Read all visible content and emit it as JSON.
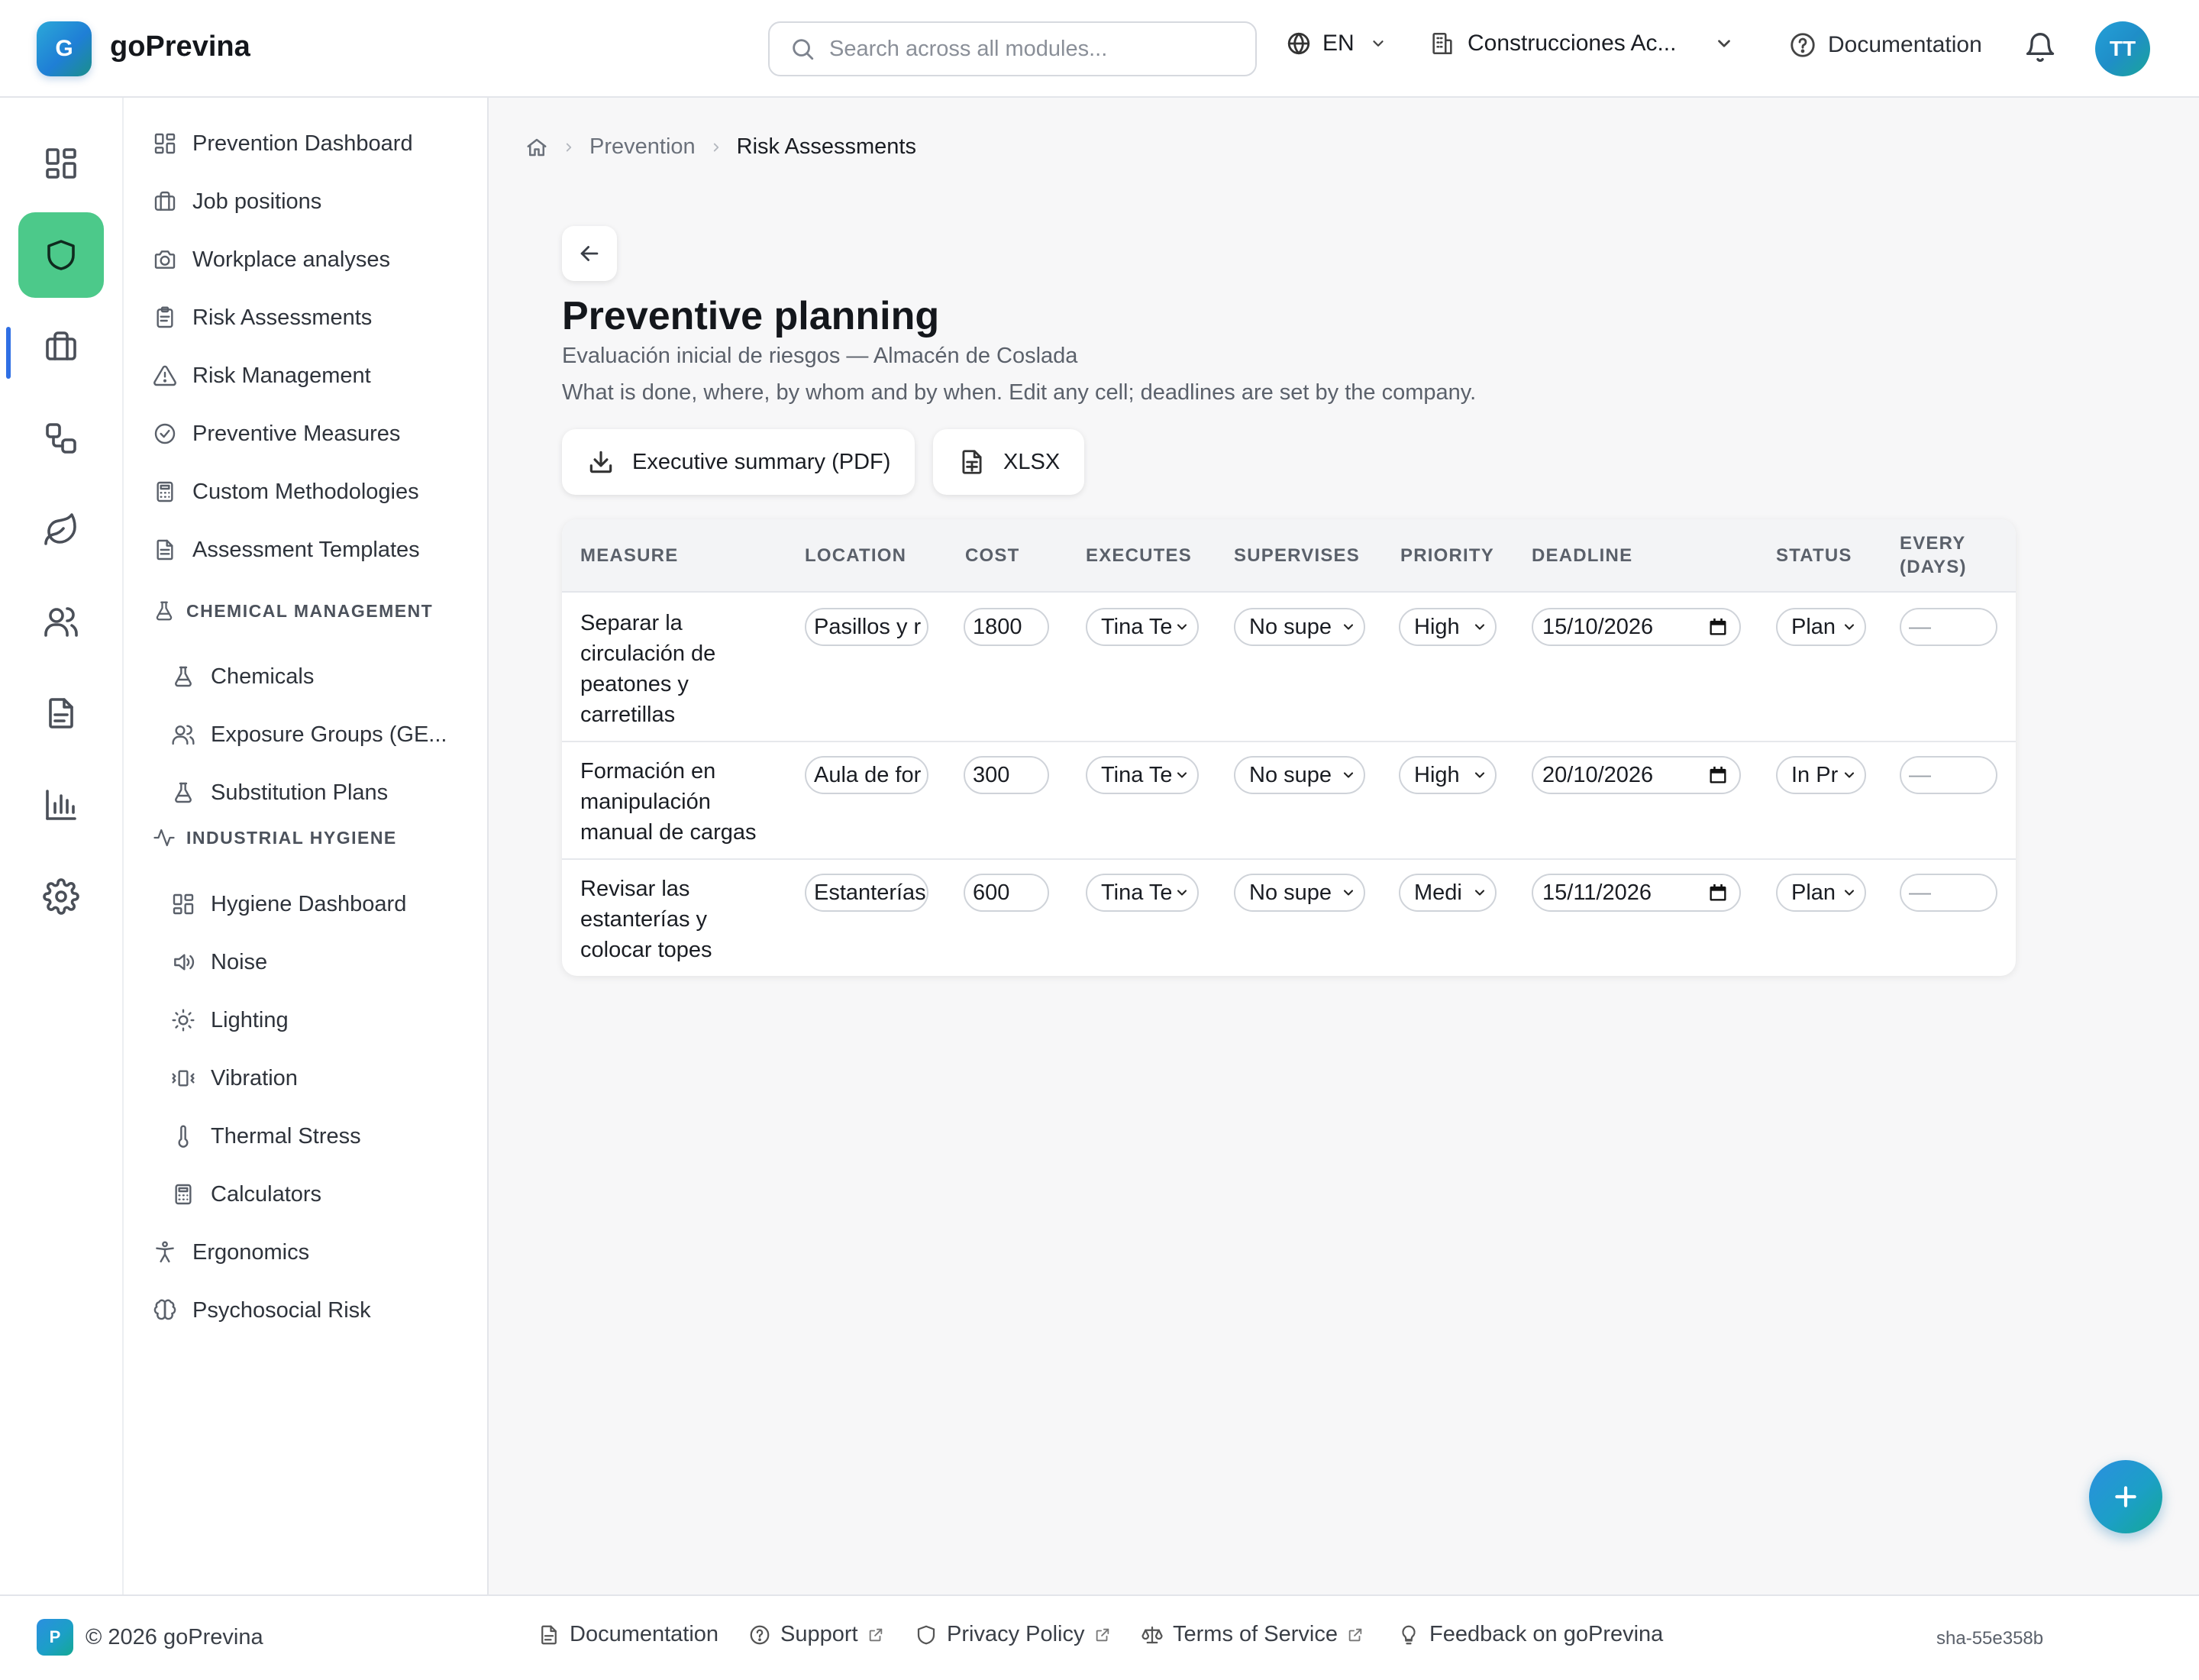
{
  "header": {
    "brand_initial": "G",
    "brand_name": "goPrevina",
    "search_placeholder": "Search across all modules...",
    "language": "EN",
    "company": "Construcciones Ac...",
    "documentation": "Documentation",
    "avatar_initials": "TT"
  },
  "rail": {
    "items": [
      "dashboard-icon",
      "shield-icon",
      "briefcase-icon",
      "workflow-icon",
      "leaf-icon",
      "users-icon",
      "document-icon",
      "bar-chart-icon",
      "gear-icon"
    ],
    "active_index": 1,
    "active_color": "#4cc98a"
  },
  "sidebar": {
    "items": [
      {
        "label": "Prevention Dashboard",
        "icon": "dashboard-icon"
      },
      {
        "label": "Job positions",
        "icon": "briefcase-icon"
      },
      {
        "label": "Workplace analyses",
        "icon": "camera-icon"
      },
      {
        "label": "Risk Assessments",
        "icon": "clipboard-icon"
      },
      {
        "label": "Risk Management",
        "icon": "warning-icon"
      },
      {
        "label": "Preventive Measures",
        "icon": "check-circle-icon"
      },
      {
        "label": "Custom Methodologies",
        "icon": "calculator-icon"
      },
      {
        "label": "Assessment Templates",
        "icon": "file-icon"
      }
    ],
    "chemical_section": "CHEMICAL MANAGEMENT",
    "chemical_items": [
      {
        "label": "Chemicals",
        "icon": "flask-icon"
      },
      {
        "label": "Exposure Groups (GE...",
        "icon": "users-icon"
      },
      {
        "label": "Substitution Plans",
        "icon": "flask-icon"
      }
    ],
    "hygiene_section": "INDUSTRIAL HYGIENE",
    "hygiene_items": [
      {
        "label": "Hygiene Dashboard",
        "icon": "dashboard-icon"
      },
      {
        "label": "Noise",
        "icon": "speaker-icon"
      },
      {
        "label": "Lighting",
        "icon": "sun-icon"
      },
      {
        "label": "Vibration",
        "icon": "vibration-icon"
      },
      {
        "label": "Thermal Stress",
        "icon": "thermometer-icon"
      },
      {
        "label": "Calculators",
        "icon": "calculator-icon"
      }
    ],
    "bottom_items": [
      {
        "label": "Ergonomics",
        "icon": "person-icon"
      },
      {
        "label": "Psychosocial Risk",
        "icon": "brain-icon"
      }
    ]
  },
  "breadcrumb": {
    "prevention": "Prevention",
    "current": "Risk Assessments"
  },
  "page": {
    "title": "Preventive planning",
    "subtitle": "Evaluación inicial de riesgos — Almacén de Coslada",
    "description": "What is done, where, by whom and by when. Edit any cell; deadlines are set by the company.",
    "pdf_button": "Executive summary (PDF)",
    "xlsx_button": "XLSX"
  },
  "table": {
    "headers": {
      "measure": "MEASURE",
      "location": "LOCATION",
      "cost": "COST",
      "executes": "EXECUTES",
      "supervises": "SUPERVISES",
      "priority": "PRIORITY",
      "deadline": "DEADLINE",
      "status": "STATUS",
      "every_line1": "EVERY",
      "every_line2": "(DAYS)"
    },
    "rows": [
      {
        "measure": "Separar la circulación de peatones y carretillas",
        "location": "Pasillos y r",
        "cost": "1800",
        "executes": "Tina Te",
        "supervises": "No supe",
        "priority": "High",
        "deadline": "15/10/2026",
        "status": "Plan",
        "every": "—"
      },
      {
        "measure": "Formación en manipulación manual de cargas",
        "location": "Aula de for",
        "cost": "300",
        "executes": "Tina Te",
        "supervises": "No supe",
        "priority": "High",
        "deadline": "20/10/2026",
        "status": "In Pr",
        "every": "—"
      },
      {
        "measure": "Revisar las estanterías y colocar topes",
        "location": "Estanterías",
        "cost": "600",
        "executes": "Tina Te",
        "supervises": "No supe",
        "priority": "Medi",
        "deadline": "15/11/2026",
        "status": "Plan",
        "every": "—"
      }
    ]
  },
  "footer": {
    "logo_initial": "P",
    "copyright": "© 2026 goPrevina",
    "documentation": "Documentation",
    "support": "Support",
    "privacy": "Privacy Policy",
    "terms": "Terms of Service",
    "feedback": "Feedback on goPrevina",
    "build": "sha-55e358b"
  }
}
